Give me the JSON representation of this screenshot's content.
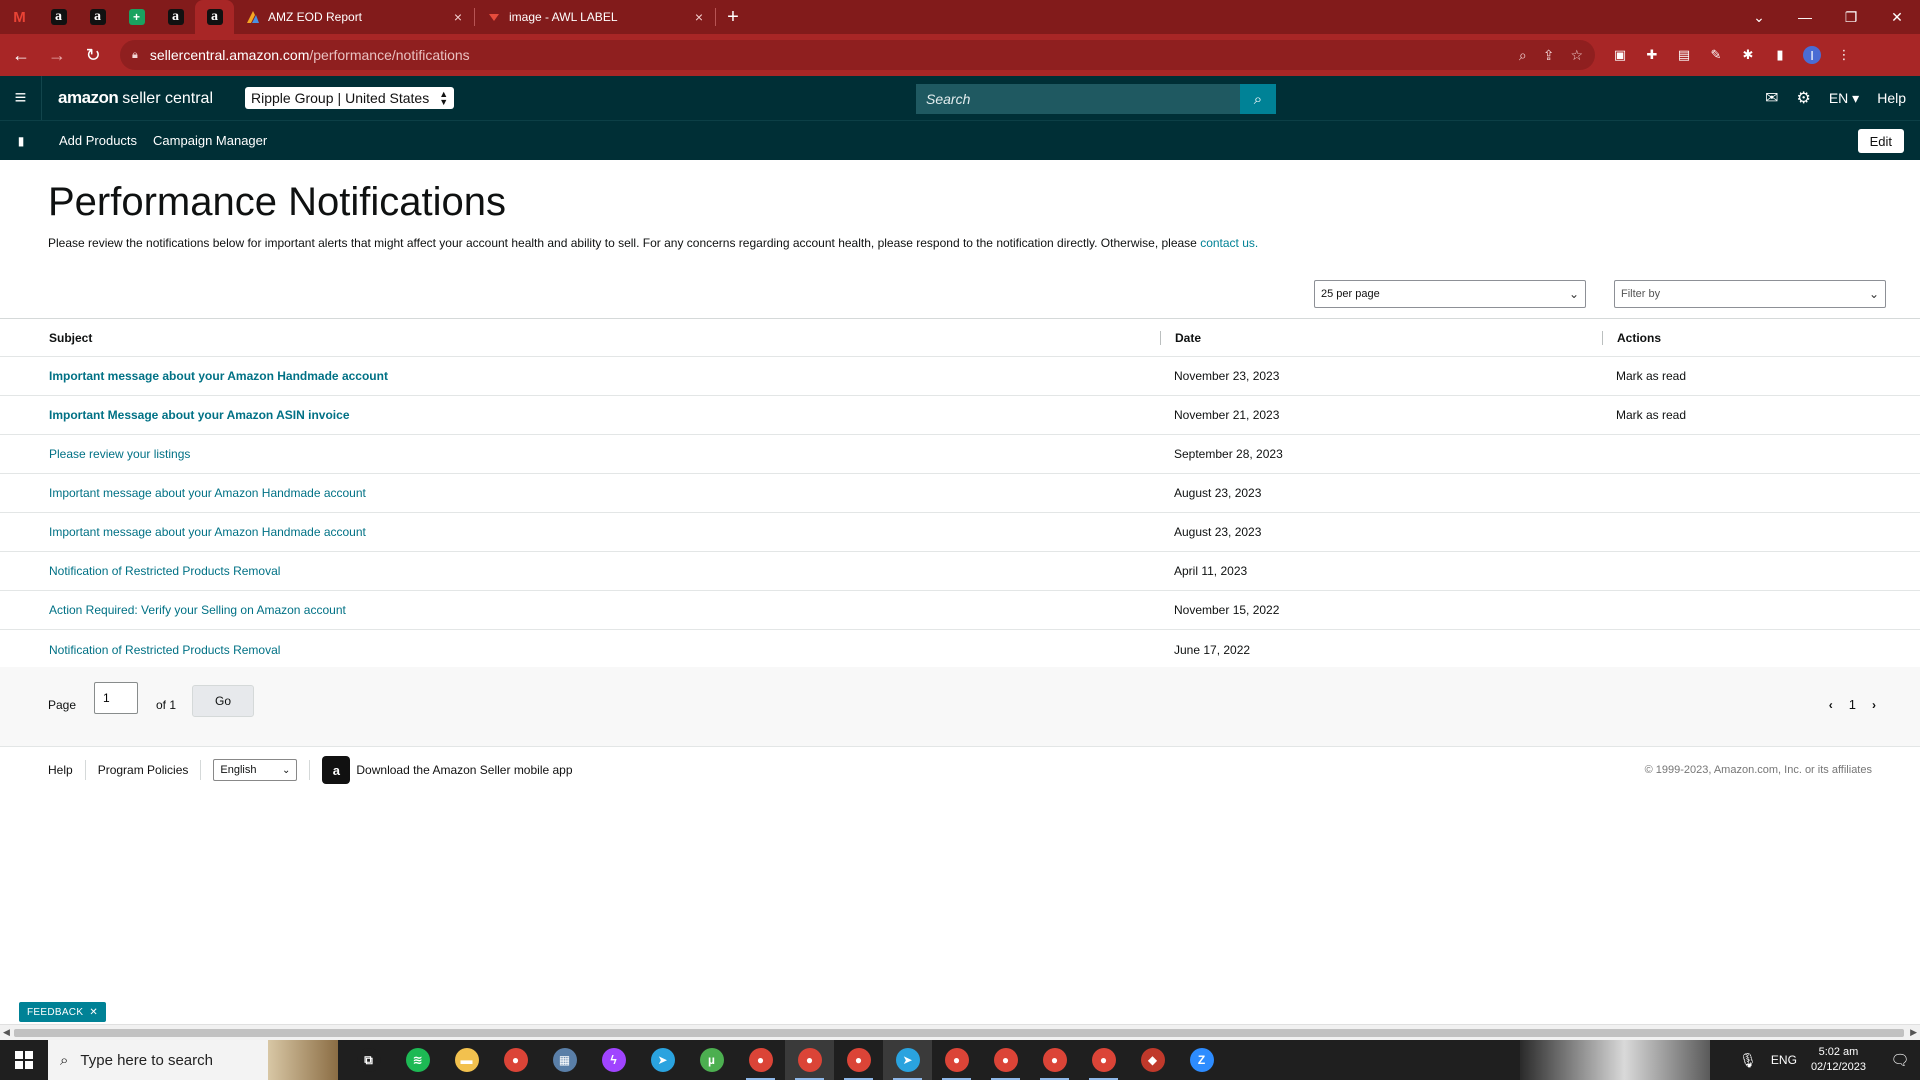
{
  "browser": {
    "pinned_tabs": [
      {
        "name": "gmail",
        "glyph": "M"
      },
      {
        "name": "amazon",
        "glyph": "a"
      },
      {
        "name": "amazon",
        "glyph": "a"
      },
      {
        "name": "sheets",
        "glyph": "+"
      },
      {
        "name": "amazon",
        "glyph": "a"
      },
      {
        "name": "amazon",
        "glyph": "a"
      }
    ],
    "tabs": [
      {
        "title": "AMZ EOD Report",
        "close": "×"
      },
      {
        "title": "image - AWL LABEL",
        "close": "×"
      }
    ],
    "new_tab": "+",
    "url_host": "sellercentral.amazon.com",
    "url_path": "/performance/notifications",
    "profile_initial": "I"
  },
  "header": {
    "logo_amazon": "amazon",
    "logo_seller_central": "seller central",
    "account": "Ripple Group",
    "marketplace": "United States",
    "search_placeholder": "Search",
    "lang": "EN",
    "help": "Help"
  },
  "subnav": {
    "links": [
      "Add Products",
      "Campaign Manager"
    ],
    "edit": "Edit"
  },
  "main": {
    "title": "Performance Notifications",
    "intro": "Please review the notifications below for important alerts that might affect your account health and ability to sell. For any concerns regarding account health, please respond to the notification directly. Otherwise, please",
    "intro_link": "contact us.",
    "per_page": "25 per page",
    "filter_by": "Filter by"
  },
  "table": {
    "headers": {
      "subject": "Subject",
      "date": "Date",
      "actions": "Actions"
    },
    "rows": [
      {
        "subject": "Important message about your Amazon Handmade account",
        "date": "November 23, 2023",
        "action": "Mark as read",
        "unread": true
      },
      {
        "subject": "Important Message about your Amazon ASIN invoice",
        "date": "November 21, 2023",
        "action": "Mark as read",
        "unread": true
      },
      {
        "subject": "Please review your listings",
        "date": "September 28, 2023",
        "action": "",
        "unread": false
      },
      {
        "subject": "Important message about your Amazon Handmade account",
        "date": "August 23, 2023",
        "action": "",
        "unread": false
      },
      {
        "subject": "Important message about your Amazon Handmade account",
        "date": "August 23, 2023",
        "action": "",
        "unread": false
      },
      {
        "subject": "Notification of Restricted Products Removal",
        "date": "April 11, 2023",
        "action": "",
        "unread": false
      },
      {
        "subject": "Action Required: Verify your Selling on Amazon account",
        "date": "November 15, 2022",
        "action": "",
        "unread": false
      },
      {
        "subject": "Notification of Restricted Products Removal",
        "date": "June 17, 2022",
        "action": "",
        "unread": false
      }
    ]
  },
  "pagination": {
    "page_label": "Page",
    "page_value": "1",
    "of_label": "of 1",
    "go": "Go",
    "current": "1"
  },
  "footer": {
    "help": "Help",
    "program_policies": "Program Policies",
    "language": "English",
    "app_download": "Download the Amazon Seller mobile app",
    "copyright": "© 1999-2023, Amazon.com, Inc. or its affiliates"
  },
  "feedback": "FEEDBACK",
  "taskbar": {
    "search_placeholder": "Type here to search",
    "lang": "ENG",
    "time": "5:02 am",
    "date": "02/12/2023",
    "apps": [
      {
        "icon": "task-view-icon",
        "color": "#1f1f1f",
        "glyph": "⧉"
      },
      {
        "icon": "spotify-icon",
        "color": "#1db954",
        "glyph": "≋"
      },
      {
        "icon": "file-explorer-icon",
        "color": "#f2c14e",
        "glyph": "▬"
      },
      {
        "icon": "chrome-icon",
        "color": "#db4437",
        "glyph": "●"
      },
      {
        "icon": "calculator-icon",
        "color": "#5a7fa8",
        "glyph": "▦"
      },
      {
        "icon": "messenger-icon",
        "color": "#a044ff",
        "glyph": "ϟ"
      },
      {
        "icon": "telegram-icon",
        "color": "#2aa3df",
        "glyph": "➤"
      },
      {
        "icon": "utorrent-icon",
        "color": "#4caf50",
        "glyph": "µ"
      },
      {
        "icon": "chrome-profile-icon",
        "color": "#db4437",
        "glyph": "●"
      },
      {
        "icon": "chrome-profile-icon",
        "color": "#db4437",
        "glyph": "●"
      },
      {
        "icon": "chrome-profile-icon",
        "color": "#db4437",
        "glyph": "●"
      },
      {
        "icon": "telegram-icon",
        "color": "#2aa3df",
        "glyph": "➤"
      },
      {
        "icon": "chrome-profile-icon",
        "color": "#db4437",
        "glyph": "●"
      },
      {
        "icon": "chrome-profile-icon",
        "color": "#db4437",
        "glyph": "●"
      },
      {
        "icon": "chrome-profile-icon",
        "color": "#db4437",
        "glyph": "●"
      },
      {
        "icon": "chrome-icon",
        "color": "#db4437",
        "glyph": "●"
      },
      {
        "icon": "app-icon",
        "color": "#c0392b",
        "glyph": "◆"
      },
      {
        "icon": "zoom-icon",
        "color": "#2d8cff",
        "glyph": "Z"
      }
    ]
  },
  "colors": {
    "tabbar": "#821b1b",
    "header": "#002f36",
    "link": "#007185",
    "accent": "#008296"
  }
}
